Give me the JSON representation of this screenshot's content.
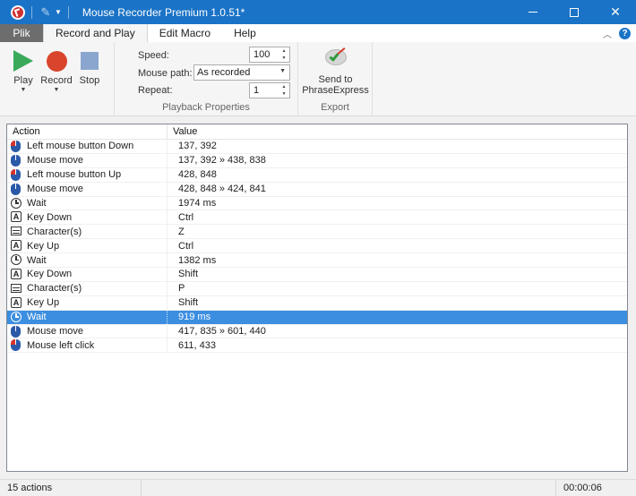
{
  "window": {
    "title": "Mouse Recorder Premium 1.0.51*",
    "accent_color": "#1a73c6"
  },
  "tabs": [
    "Plik",
    "Record and Play",
    "Edit Macro",
    "Help"
  ],
  "ribbon": {
    "playback": {
      "play_label": "Play",
      "record_label": "Record",
      "stop_label": "Stop",
      "speed_label": "Speed:",
      "speed_value": "100",
      "mouse_path_label": "Mouse path:",
      "mouse_path_value": "As recorded",
      "repeat_label": "Repeat:",
      "repeat_value": "1",
      "group_label": "Playback Properties"
    },
    "export": {
      "send_label_1": "Send to",
      "send_label_2": "PhraseExpress",
      "group_label": "Export"
    }
  },
  "list": {
    "columns": [
      "Action",
      "Value"
    ],
    "selected_index": 12,
    "rows": [
      {
        "icon": "mouse-left-icon",
        "action": "Left mouse button Down",
        "value": "137, 392"
      },
      {
        "icon": "mouse-icon",
        "action": "Mouse move",
        "value": "137, 392 » 438, 838"
      },
      {
        "icon": "mouse-left-icon",
        "action": "Left mouse button Up",
        "value": "428, 848"
      },
      {
        "icon": "mouse-icon",
        "action": "Mouse move",
        "value": "428, 848 » 424, 841"
      },
      {
        "icon": "clock-icon",
        "action": "Wait",
        "value": "1974 ms"
      },
      {
        "icon": "key-icon",
        "action": "Key Down",
        "value": "Ctrl"
      },
      {
        "icon": "keyboard-icon",
        "action": "Character(s)",
        "value": "Z"
      },
      {
        "icon": "key-icon",
        "action": "Key Up",
        "value": "Ctrl"
      },
      {
        "icon": "clock-icon",
        "action": "Wait",
        "value": "1382 ms"
      },
      {
        "icon": "key-icon",
        "action": "Key Down",
        "value": "Shift"
      },
      {
        "icon": "keyboard-icon",
        "action": "Character(s)",
        "value": "P"
      },
      {
        "icon": "key-icon",
        "action": "Key Up",
        "value": "Shift"
      },
      {
        "icon": "clock-icon",
        "action": "Wait",
        "value": "919 ms"
      },
      {
        "icon": "mouse-icon",
        "action": "Mouse move",
        "value": "417, 835 » 601, 440"
      },
      {
        "icon": "mouse-left-icon",
        "action": "Mouse left click",
        "value": "611, 433"
      }
    ]
  },
  "status": {
    "count": "15 actions",
    "duration": "00:00:06"
  }
}
